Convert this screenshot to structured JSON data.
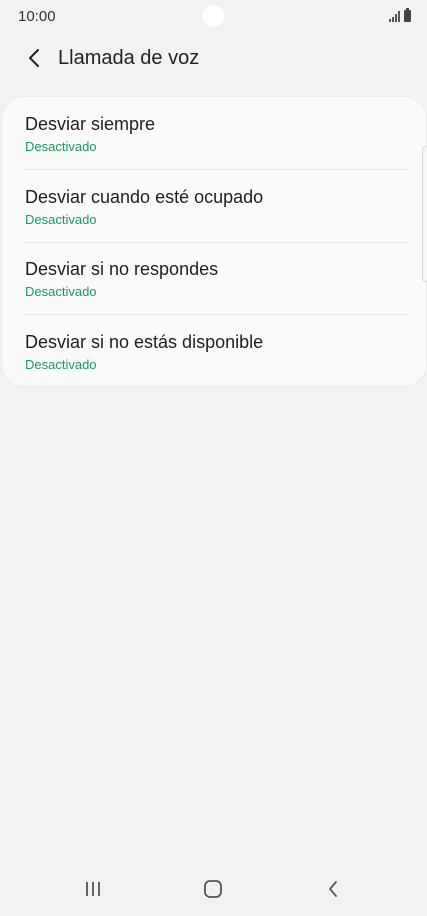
{
  "status_bar": {
    "time": "10:00",
    "icons": [
      "signal-icon",
      "battery-icon"
    ]
  },
  "header": {
    "back_icon": "chevron-left-icon",
    "title": "Llamada de voz"
  },
  "forwarding_options": [
    {
      "title": "Desviar siempre",
      "status": "Desactivado"
    },
    {
      "title": "Desviar cuando esté ocupado",
      "status": "Desactivado"
    },
    {
      "title": "Desviar si no respondes",
      "status": "Desactivado"
    },
    {
      "title": "Desviar si no estás disponible",
      "status": "Desactivado"
    }
  ],
  "nav_bar": {
    "recents_icon": "recents-icon",
    "home_icon": "home-icon",
    "back_icon": "back-icon"
  },
  "colors": {
    "background": "#f2f2f2",
    "card": "#fafafa",
    "status_text": "#1c9a5c",
    "primary_text": "#1f1f1f"
  }
}
